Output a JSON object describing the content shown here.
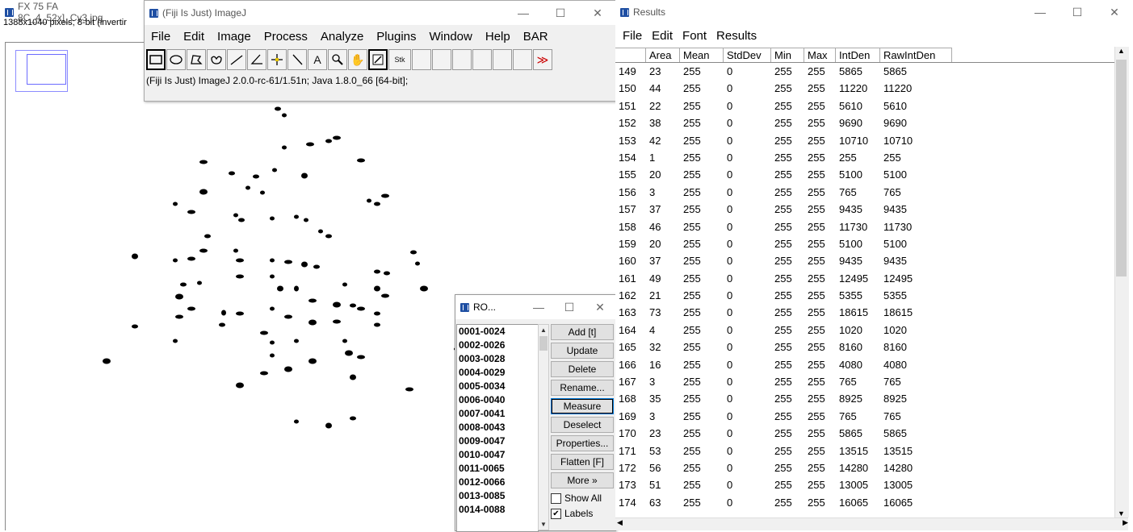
{
  "image_window": {
    "title": "FX 75 FA 8C_4_52x]_Cy3.jpg",
    "info": "1388x1040 pixels; 8-bit (invertir"
  },
  "imagej_window": {
    "title": "(Fiji Is Just) ImageJ",
    "menu": [
      "File",
      "Edit",
      "Image",
      "Process",
      "Analyze",
      "Plugins",
      "Window",
      "Help",
      "BAR"
    ],
    "tools": [
      "rectangle-tool",
      "oval-tool",
      "polygon-tool",
      "freehand-tool",
      "line-tool",
      "angle-tool",
      "point-tool",
      "wand-tool",
      "text-tool",
      "zoom-tool",
      "hand-tool",
      "color-picker-tool"
    ],
    "stk_label": "Stk",
    "more_label": "≫",
    "status": "(Fiji Is Just) ImageJ 2.0.0-rc-61/1.51n; Java 1.8.0_66 [64-bit];"
  },
  "roi_manager": {
    "title": "RO...",
    "items": [
      "0001-0024",
      "0002-0026",
      "0003-0028",
      "0004-0029",
      "0005-0034",
      "0006-0040",
      "0007-0041",
      "0008-0043",
      "0009-0047",
      "0010-0047",
      "0011-0065",
      "0012-0066",
      "0013-0085",
      "0014-0088"
    ],
    "buttons": {
      "add": "Add [t]",
      "update": "Update",
      "delete": "Delete",
      "rename": "Rename...",
      "measure": "Measure",
      "deselect": "Deselect",
      "properties": "Properties...",
      "flatten": "Flatten [F]",
      "more": "More »"
    },
    "show_all": "Show All",
    "labels": "Labels",
    "labels_checked": true,
    "show_all_checked": false
  },
  "results_window": {
    "title": "Results",
    "menu": [
      "File",
      "Edit",
      "Font",
      "Results"
    ],
    "columns": [
      "",
      "Area",
      "Mean",
      "StdDev",
      "Min",
      "Max",
      "IntDen",
      "RawIntDen"
    ],
    "rows": [
      [
        "149",
        "23",
        "255",
        "0",
        "255",
        "255",
        "5865",
        "5865"
      ],
      [
        "150",
        "44",
        "255",
        "0",
        "255",
        "255",
        "11220",
        "11220"
      ],
      [
        "151",
        "22",
        "255",
        "0",
        "255",
        "255",
        "5610",
        "5610"
      ],
      [
        "152",
        "38",
        "255",
        "0",
        "255",
        "255",
        "9690",
        "9690"
      ],
      [
        "153",
        "42",
        "255",
        "0",
        "255",
        "255",
        "10710",
        "10710"
      ],
      [
        "154",
        "1",
        "255",
        "0",
        "255",
        "255",
        "255",
        "255"
      ],
      [
        "155",
        "20",
        "255",
        "0",
        "255",
        "255",
        "5100",
        "5100"
      ],
      [
        "156",
        "3",
        "255",
        "0",
        "255",
        "255",
        "765",
        "765"
      ],
      [
        "157",
        "37",
        "255",
        "0",
        "255",
        "255",
        "9435",
        "9435"
      ],
      [
        "158",
        "46",
        "255",
        "0",
        "255",
        "255",
        "11730",
        "11730"
      ],
      [
        "159",
        "20",
        "255",
        "0",
        "255",
        "255",
        "5100",
        "5100"
      ],
      [
        "160",
        "37",
        "255",
        "0",
        "255",
        "255",
        "9435",
        "9435"
      ],
      [
        "161",
        "49",
        "255",
        "0",
        "255",
        "255",
        "12495",
        "12495"
      ],
      [
        "162",
        "21",
        "255",
        "0",
        "255",
        "255",
        "5355",
        "5355"
      ],
      [
        "163",
        "73",
        "255",
        "0",
        "255",
        "255",
        "18615",
        "18615"
      ],
      [
        "164",
        "4",
        "255",
        "0",
        "255",
        "255",
        "1020",
        "1020"
      ],
      [
        "165",
        "32",
        "255",
        "0",
        "255",
        "255",
        "8160",
        "8160"
      ],
      [
        "166",
        "16",
        "255",
        "0",
        "255",
        "255",
        "4080",
        "4080"
      ],
      [
        "167",
        "3",
        "255",
        "0",
        "255",
        "255",
        "765",
        "765"
      ],
      [
        "168",
        "35",
        "255",
        "0",
        "255",
        "255",
        "8925",
        "8925"
      ],
      [
        "169",
        "3",
        "255",
        "0",
        "255",
        "255",
        "765",
        "765"
      ],
      [
        "170",
        "23",
        "255",
        "0",
        "255",
        "255",
        "5865",
        "5865"
      ],
      [
        "171",
        "53",
        "255",
        "0",
        "255",
        "255",
        "13515",
        "13515"
      ],
      [
        "172",
        "56",
        "255",
        "0",
        "255",
        "255",
        "14280",
        "14280"
      ],
      [
        "173",
        "51",
        "255",
        "0",
        "255",
        "255",
        "13005",
        "13005"
      ],
      [
        "174",
        "63",
        "255",
        "0",
        "255",
        "255",
        "16065",
        "16065"
      ]
    ]
  },
  "window_controls": {
    "minimize": "—",
    "maximize": "☐",
    "close": "✕"
  },
  "colors": {
    "fiji_blue": "#1f4fa3",
    "roi_highlight": "#8c8cff"
  }
}
